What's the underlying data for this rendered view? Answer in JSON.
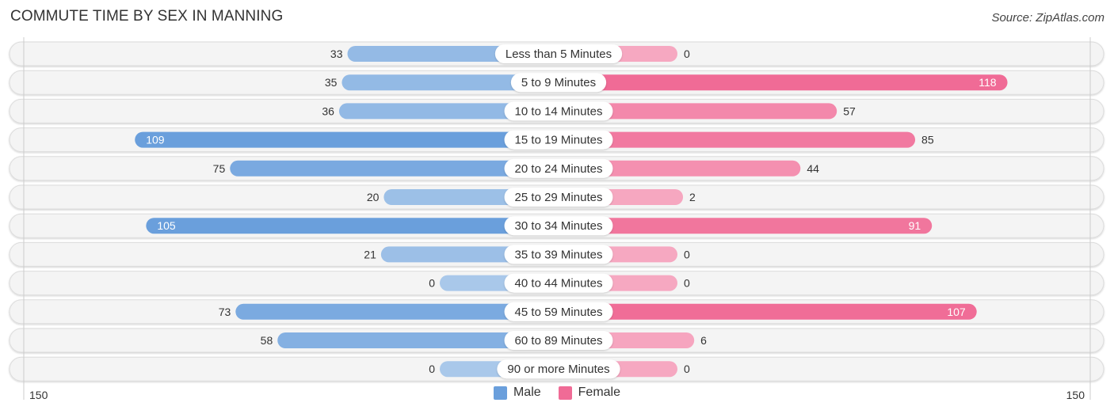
{
  "header": {
    "title": "COMMUTE TIME BY SEX IN MANNING",
    "source": "Source: ZipAtlas.com"
  },
  "legend": {
    "male_label": "Male",
    "female_label": "Female"
  },
  "colors": {
    "male_strong": "#6a9fdc",
    "male_light": "#a9c8ea",
    "female_strong": "#f06b96",
    "female_light": "#f6a8c1",
    "track": "#f3f3f3",
    "text": "#333333"
  },
  "chart_data": {
    "type": "bar",
    "orientation": "horizontal-diverging",
    "title": "COMMUTE TIME BY SEX IN MANNING",
    "categories": [
      "Less than 5 Minutes",
      "5 to 9 Minutes",
      "10 to 14 Minutes",
      "15 to 19 Minutes",
      "20 to 24 Minutes",
      "25 to 29 Minutes",
      "30 to 34 Minutes",
      "35 to 39 Minutes",
      "40 to 44 Minutes",
      "45 to 59 Minutes",
      "60 to 89 Minutes",
      "90 or more Minutes"
    ],
    "series": [
      {
        "name": "Male",
        "side": "left",
        "values": [
          33,
          35,
          36,
          109,
          75,
          20,
          105,
          21,
          0,
          73,
          58,
          0
        ]
      },
      {
        "name": "Female",
        "side": "right",
        "values": [
          0,
          118,
          57,
          85,
          44,
          2,
          91,
          0,
          0,
          107,
          6,
          0
        ]
      }
    ],
    "axis": {
      "left_tick_label": "150",
      "right_tick_label": "150",
      "max": 150
    },
    "legend_position": "bottom-center"
  }
}
